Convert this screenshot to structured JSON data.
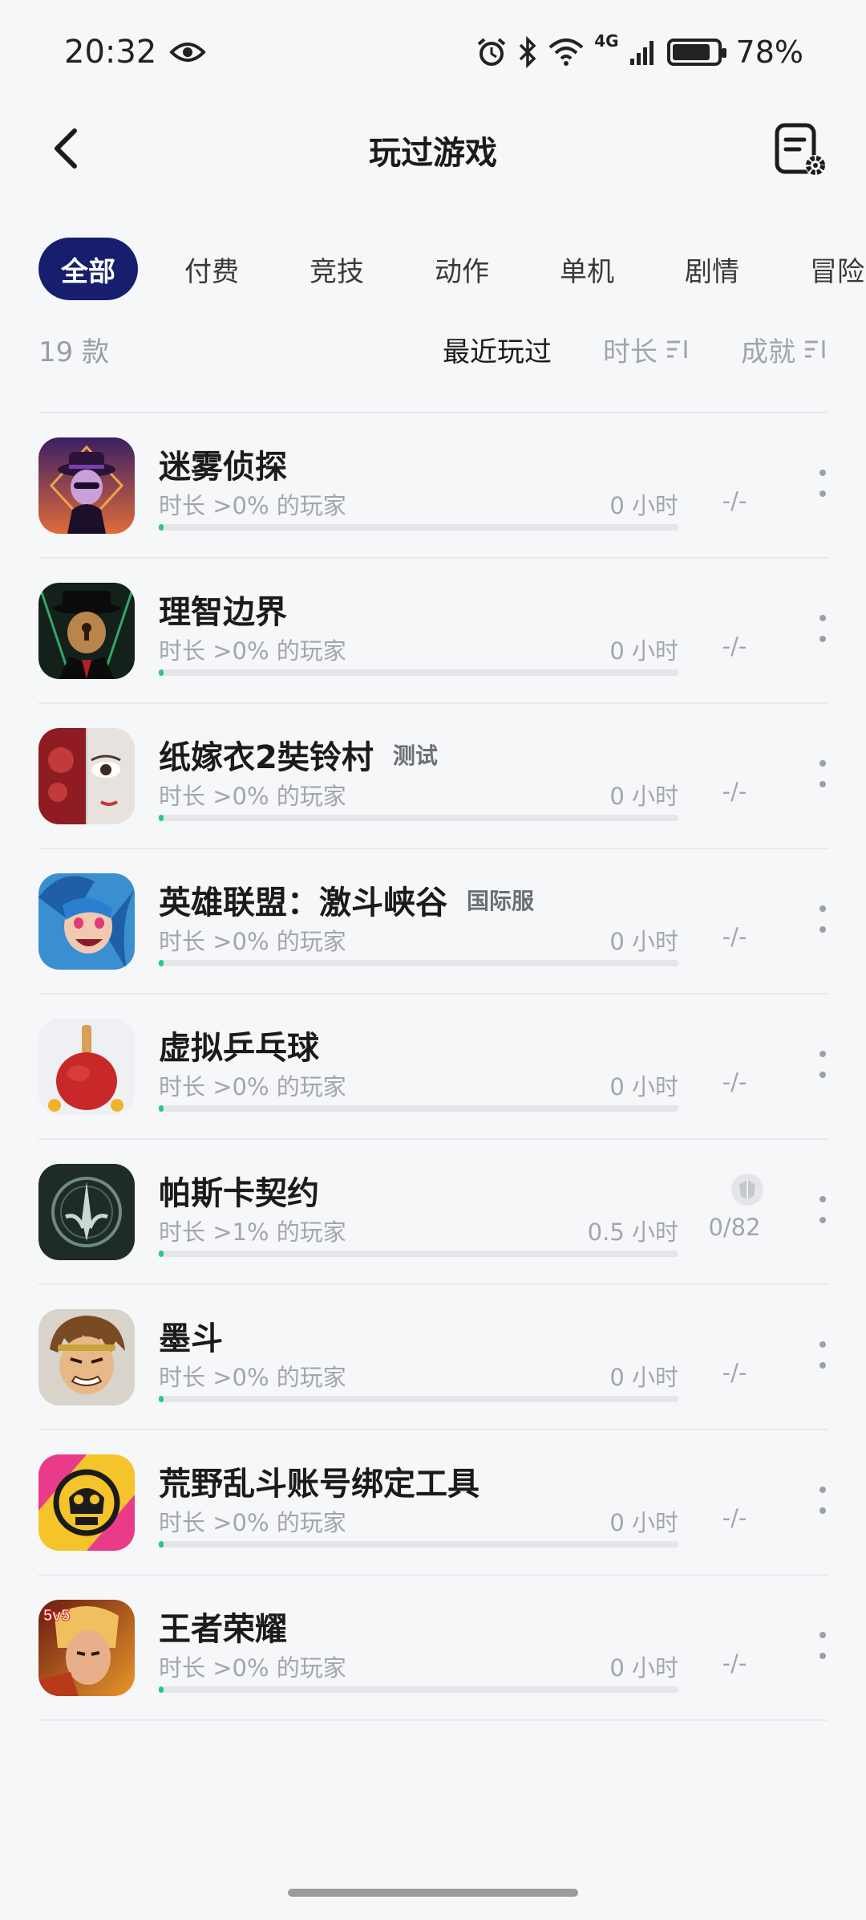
{
  "status_bar": {
    "time": "20:32",
    "battery": "78%",
    "network": "4G"
  },
  "header": {
    "title": "玩过游戏"
  },
  "tabs": [
    "全部",
    "付费",
    "竞技",
    "动作",
    "单机",
    "剧情",
    "冒险"
  ],
  "sortbar": {
    "count": "19 款",
    "recent": "最近玩过",
    "duration": "时长",
    "achievement": "成就"
  },
  "games": [
    {
      "name": "迷雾侦探",
      "tag": "",
      "sub": "时长 >0% 的玩家",
      "hours": "0 小时",
      "ach": "-/-",
      "progress": 0.01
    },
    {
      "name": "理智边界",
      "tag": "",
      "sub": "时长 >0% 的玩家",
      "hours": "0 小时",
      "ach": "-/-",
      "progress": 0.01
    },
    {
      "name": "纸嫁衣2奘铃村",
      "tag": "测试",
      "sub": "时长 >0% 的玩家",
      "hours": "0 小时",
      "ach": "-/-",
      "progress": 0.01
    },
    {
      "name": "英雄联盟：激斗峡谷",
      "tag": "国际服",
      "sub": "时长 >0% 的玩家",
      "hours": "0 小时",
      "ach": "-/-",
      "progress": 0.01
    },
    {
      "name": "虚拟乒乓球",
      "tag": "",
      "sub": "时长 >0% 的玩家",
      "hours": "0 小时",
      "ach": "-/-",
      "progress": 0.01
    },
    {
      "name": "帕斯卡契约",
      "tag": "",
      "sub": "时长 >1% 的玩家",
      "hours": "0.5 小时",
      "ach": "0/82",
      "progress": 0.01
    },
    {
      "name": "墨斗",
      "tag": "",
      "sub": "时长 >0% 的玩家",
      "hours": "0 小时",
      "ach": "-/-",
      "progress": 0.01
    },
    {
      "name": "荒野乱斗账号绑定工具",
      "tag": "",
      "sub": "时长 >0% 的玩家",
      "hours": "0 小时",
      "ach": "-/-",
      "progress": 0.01
    },
    {
      "name": "王者荣耀",
      "tag": "",
      "sub": "时长 >0% 的玩家",
      "hours": "0 小时",
      "ach": "-/-",
      "progress": 0.01
    }
  ],
  "colors": {
    "active_tab": "#171e6e",
    "progress": "#2bc48a",
    "background": "#f6f7f9"
  }
}
